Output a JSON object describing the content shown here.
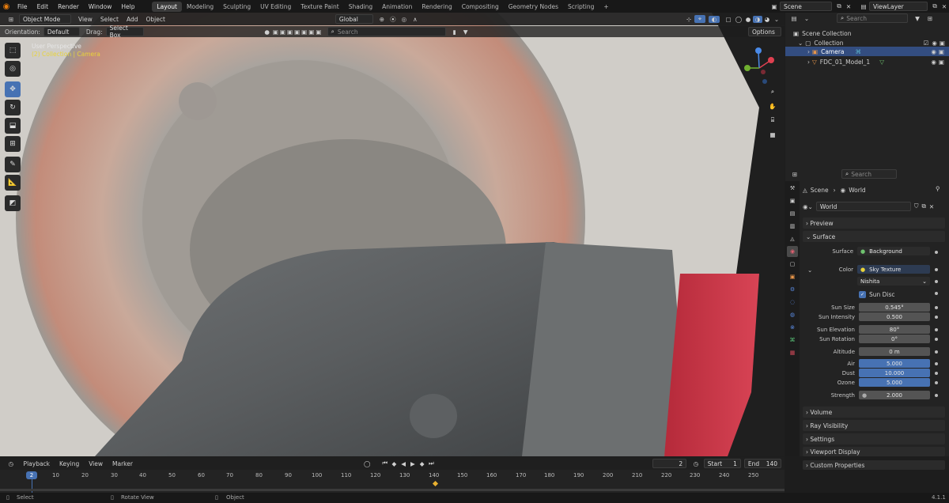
{
  "topbar": {
    "menus": [
      "File",
      "Edit",
      "Render",
      "Window",
      "Help"
    ],
    "workspaces": [
      "Layout",
      "Modeling",
      "Sculpting",
      "UV Editing",
      "Texture Paint",
      "Shading",
      "Animation",
      "Rendering",
      "Compositing",
      "Geometry Nodes",
      "Scripting"
    ],
    "active_workspace": "Layout",
    "scene": "Scene",
    "view_layer": "ViewLayer"
  },
  "viewport": {
    "mode": "Object Mode",
    "menus": [
      "View",
      "Select",
      "Add",
      "Object"
    ],
    "transform": "Global",
    "orientation_label": "Orientation:",
    "orientation_value": "Default",
    "drag_label": "Drag:",
    "drag_value": "Select Box",
    "search_placeholder": "Search",
    "options_label": "Options",
    "overlay_title": "User Perspective",
    "overlay_subtitle": "(2) Collection | Camera",
    "accent": "#4772b3"
  },
  "outliner": {
    "search_placeholder": "Search",
    "root": "Scene Collection",
    "collection": "Collection",
    "items": [
      {
        "label": "Camera",
        "selected": true
      },
      {
        "label": "FDC_01_Model_1",
        "selected": false
      }
    ]
  },
  "properties": {
    "search_placeholder": "Search",
    "breadcrumb_scene": "Scene",
    "breadcrumb_world": "World",
    "world_name": "World",
    "sections": {
      "preview": "Preview",
      "surface": "Surface",
      "volume": "Volume",
      "ray_visibility": "Ray Visibility",
      "settings": "Settings",
      "viewport_display": "Viewport Display",
      "custom_properties": "Custom Properties"
    },
    "surface_label": "Surface",
    "surface_value": "Background",
    "color_label": "Color",
    "color_value": "Sky Texture",
    "sky_type": "Nishita",
    "sun_disc": "Sun Disc",
    "fields": [
      {
        "label": "Sun Size",
        "value": "0.545°",
        "highlight": false
      },
      {
        "label": "Sun Intensity",
        "value": "0.500",
        "highlight": false
      },
      {
        "label": "Sun Elevation",
        "value": "80°",
        "highlight": false
      },
      {
        "label": "Sun Rotation",
        "value": "0°",
        "highlight": false
      },
      {
        "label": "Altitude",
        "value": "0 m",
        "highlight": false
      },
      {
        "label": "Air",
        "value": "5.000",
        "highlight": true
      },
      {
        "label": "Dust",
        "value": "10.000",
        "highlight": true
      },
      {
        "label": "Ozone",
        "value": "5.000",
        "highlight": true
      },
      {
        "label": "Strength",
        "value": "2.000",
        "highlight": false
      }
    ]
  },
  "timeline": {
    "menus": [
      "Playback",
      "Keying",
      "View",
      "Marker"
    ],
    "current_frame": "2",
    "start_label": "Start",
    "start_value": "1",
    "end_label": "End",
    "end_value": "140",
    "ticks": [
      "10",
      "20",
      "30",
      "40",
      "50",
      "60",
      "70",
      "80",
      "90",
      "100",
      "110",
      "120",
      "130",
      "140",
      "150",
      "160",
      "170",
      "180",
      "190",
      "200",
      "210",
      "220",
      "230",
      "240",
      "250"
    ],
    "playhead": "2"
  },
  "statusbar": {
    "select": "Select",
    "rotate": "Rotate View",
    "object": "Object",
    "version": "4.1.1"
  }
}
